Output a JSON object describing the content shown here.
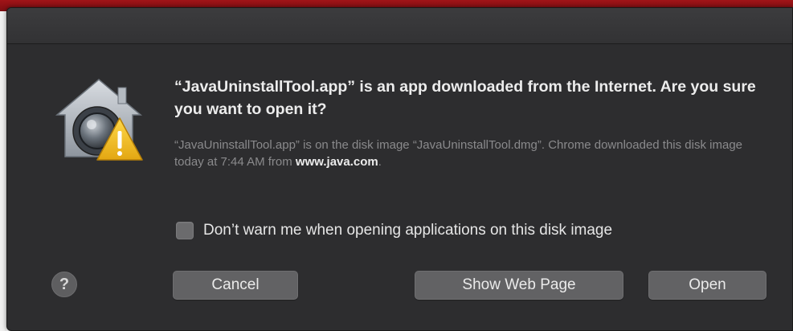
{
  "dialog": {
    "headline": "“JavaUninstallTool.app” is an app downloaded from the Internet. Are you sure you want to open it?",
    "info_text": "“JavaUninstallTool.app” is on the disk image “JavaUninstallTool.dmg”. Chrome downloaded this disk image today at 7:44 AM from ",
    "info_domain": "www.java.com",
    "info_period": ".",
    "checkbox_label": "Don’t warn me when opening applications on this disk image",
    "checkbox_checked": false,
    "help_label": "?",
    "buttons": {
      "cancel": "Cancel",
      "show_web_page": "Show Web Page",
      "open": "Open"
    },
    "icon": "gatekeeper-warning-icon"
  },
  "colors": {
    "dialog_bg": "#2d2d2f",
    "button_bg": "#626264",
    "headline_text": "#ececec",
    "secondary_text": "#8a8a8c",
    "warning_yellow": "#f5c518",
    "desktop_red": "#a01418"
  }
}
